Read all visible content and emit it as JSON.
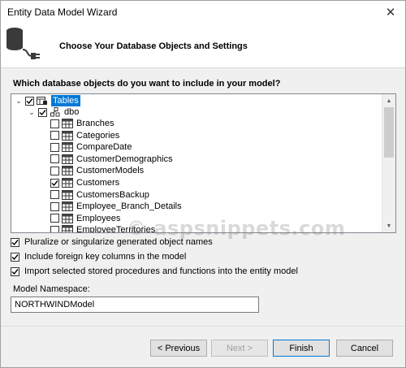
{
  "window": {
    "title": "Entity Data Model Wizard"
  },
  "header": {
    "title": "Choose Your Database Objects and Settings"
  },
  "question": "Which database objects do you want to include in your model?",
  "tree": {
    "root": {
      "label": "Tables",
      "checked": true
    },
    "schema": {
      "label": "dbo",
      "checked": true
    },
    "items": [
      {
        "label": "Branches",
        "checked": false
      },
      {
        "label": "Categories",
        "checked": false
      },
      {
        "label": "CompareDate",
        "checked": false
      },
      {
        "label": "CustomerDemographics",
        "checked": false
      },
      {
        "label": "CustomerModels",
        "checked": false
      },
      {
        "label": "Customers",
        "checked": true
      },
      {
        "label": "CustomersBackup",
        "checked": false
      },
      {
        "label": "Employee_Branch_Details",
        "checked": false
      },
      {
        "label": "Employees",
        "checked": false
      },
      {
        "label": "EmployeeTerritories",
        "checked": false
      }
    ]
  },
  "options": {
    "pluralize": {
      "label": "Pluralize or singularize generated object names",
      "checked": true
    },
    "foreign_keys": {
      "label": "Include foreign key columns in the model",
      "checked": true
    },
    "stored_procs": {
      "label": "Import selected stored procedures and functions into the entity model",
      "checked": true
    }
  },
  "namespace": {
    "label": "Model Namespace:",
    "value": "NORTHWINDModel"
  },
  "buttons": {
    "previous": "< Previous",
    "next": "Next >",
    "finish": "Finish",
    "cancel": "Cancel"
  },
  "watermark": "© aspsnippets.com",
  "colors": {
    "selection": "#0078d7",
    "default_button_border": "#0078d7"
  }
}
